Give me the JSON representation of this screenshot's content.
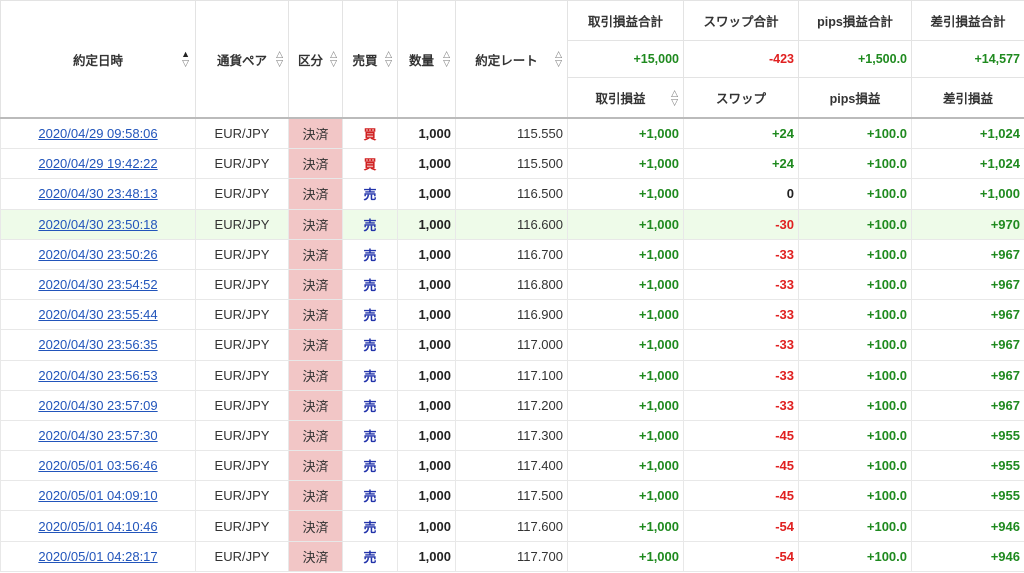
{
  "headers": {
    "date": "約定日時",
    "pair": "通貨ペア",
    "kubun": "区分",
    "side": "売買",
    "qty": "数量",
    "rate": "約定レート",
    "pl_total": "取引損益合計",
    "swap_total": "スワップ合計",
    "pips_total": "pips損益合計",
    "net_total": "差引損益合計",
    "pl": "取引損益",
    "swap": "スワップ",
    "pips": "pips損益",
    "net": "差引損益"
  },
  "sort_icons": {
    "up": "▲",
    "up_outline": "△",
    "down_outline": "▽"
  },
  "totals": {
    "pl": "+15,000",
    "swap": "-423",
    "pips": "+1,500.0",
    "net": "+14,577"
  },
  "colors": {
    "positive": "#1f8a1f",
    "negative": "#e02020",
    "kubun_bg": "#f2c6c6",
    "buy": "#d02020",
    "sell": "#2233aa",
    "link": "#2255bb",
    "highlight_row": "#eefbe9"
  },
  "rows": [
    {
      "date": "2020/04/29 09:58:06",
      "pair": "EUR/JPY",
      "kubun": "決済",
      "side": "買",
      "side_type": "buy",
      "qty": "1,000",
      "rate": "115.550",
      "pl": "+1,000",
      "swap": "+24",
      "pips": "+100.0",
      "net": "+1,024"
    },
    {
      "date": "2020/04/29 19:42:22",
      "pair": "EUR/JPY",
      "kubun": "決済",
      "side": "買",
      "side_type": "buy",
      "qty": "1,000",
      "rate": "115.500",
      "pl": "+1,000",
      "swap": "+24",
      "pips": "+100.0",
      "net": "+1,024"
    },
    {
      "date": "2020/04/30 23:48:13",
      "pair": "EUR/JPY",
      "kubun": "決済",
      "side": "売",
      "side_type": "sell",
      "qty": "1,000",
      "rate": "116.500",
      "pl": "+1,000",
      "swap": "0",
      "pips": "+100.0",
      "net": "+1,000"
    },
    {
      "date": "2020/04/30 23:50:18",
      "pair": "EUR/JPY",
      "kubun": "決済",
      "side": "売",
      "side_type": "sell",
      "qty": "1,000",
      "rate": "116.600",
      "pl": "+1,000",
      "swap": "-30",
      "pips": "+100.0",
      "net": "+970",
      "highlight": true
    },
    {
      "date": "2020/04/30 23:50:26",
      "pair": "EUR/JPY",
      "kubun": "決済",
      "side": "売",
      "side_type": "sell",
      "qty": "1,000",
      "rate": "116.700",
      "pl": "+1,000",
      "swap": "-33",
      "pips": "+100.0",
      "net": "+967"
    },
    {
      "date": "2020/04/30 23:54:52",
      "pair": "EUR/JPY",
      "kubun": "決済",
      "side": "売",
      "side_type": "sell",
      "qty": "1,000",
      "rate": "116.800",
      "pl": "+1,000",
      "swap": "-33",
      "pips": "+100.0",
      "net": "+967"
    },
    {
      "date": "2020/04/30 23:55:44",
      "pair": "EUR/JPY",
      "kubun": "決済",
      "side": "売",
      "side_type": "sell",
      "qty": "1,000",
      "rate": "116.900",
      "pl": "+1,000",
      "swap": "-33",
      "pips": "+100.0",
      "net": "+967"
    },
    {
      "date": "2020/04/30 23:56:35",
      "pair": "EUR/JPY",
      "kubun": "決済",
      "side": "売",
      "side_type": "sell",
      "qty": "1,000",
      "rate": "117.000",
      "pl": "+1,000",
      "swap": "-33",
      "pips": "+100.0",
      "net": "+967"
    },
    {
      "date": "2020/04/30 23:56:53",
      "pair": "EUR/JPY",
      "kubun": "決済",
      "side": "売",
      "side_type": "sell",
      "qty": "1,000",
      "rate": "117.100",
      "pl": "+1,000",
      "swap": "-33",
      "pips": "+100.0",
      "net": "+967"
    },
    {
      "date": "2020/04/30 23:57:09",
      "pair": "EUR/JPY",
      "kubun": "決済",
      "side": "売",
      "side_type": "sell",
      "qty": "1,000",
      "rate": "117.200",
      "pl": "+1,000",
      "swap": "-33",
      "pips": "+100.0",
      "net": "+967"
    },
    {
      "date": "2020/04/30 23:57:30",
      "pair": "EUR/JPY",
      "kubun": "決済",
      "side": "売",
      "side_type": "sell",
      "qty": "1,000",
      "rate": "117.300",
      "pl": "+1,000",
      "swap": "-45",
      "pips": "+100.0",
      "net": "+955"
    },
    {
      "date": "2020/05/01 03:56:46",
      "pair": "EUR/JPY",
      "kubun": "決済",
      "side": "売",
      "side_type": "sell",
      "qty": "1,000",
      "rate": "117.400",
      "pl": "+1,000",
      "swap": "-45",
      "pips": "+100.0",
      "net": "+955"
    },
    {
      "date": "2020/05/01 04:09:10",
      "pair": "EUR/JPY",
      "kubun": "決済",
      "side": "売",
      "side_type": "sell",
      "qty": "1,000",
      "rate": "117.500",
      "pl": "+1,000",
      "swap": "-45",
      "pips": "+100.0",
      "net": "+955"
    },
    {
      "date": "2020/05/01 04:10:46",
      "pair": "EUR/JPY",
      "kubun": "決済",
      "side": "売",
      "side_type": "sell",
      "qty": "1,000",
      "rate": "117.600",
      "pl": "+1,000",
      "swap": "-54",
      "pips": "+100.0",
      "net": "+946"
    },
    {
      "date": "2020/05/01 04:28:17",
      "pair": "EUR/JPY",
      "kubun": "決済",
      "side": "売",
      "side_type": "sell",
      "qty": "1,000",
      "rate": "117.700",
      "pl": "+1,000",
      "swap": "-54",
      "pips": "+100.0",
      "net": "+946"
    }
  ]
}
